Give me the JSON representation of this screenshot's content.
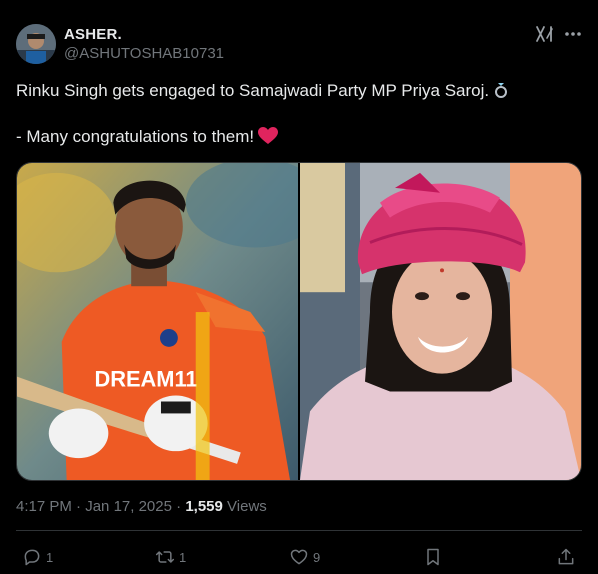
{
  "author": {
    "display_name": "ASHER.",
    "handle": "@ASHUTOSHAB10731"
  },
  "tweet": {
    "line1": "Rinku Singh gets engaged to Samajwadi Party MP Priya Saroj.",
    "line2": "- Many congratulations to them!"
  },
  "media": {
    "left_photo_jersey_text": "DREAM11",
    "photos": [
      "cricketer-photo",
      "woman-in-pink-turban-photo"
    ]
  },
  "meta": {
    "time": "4:17 PM",
    "separator": "·",
    "date": "Jan 17, 2025",
    "views_count": "1,559",
    "views_label": "Views"
  },
  "actions": {
    "replies": "1",
    "reposts": "1",
    "likes": "9"
  },
  "colors": {
    "background": "#000000",
    "text": "#e7e9ea",
    "muted": "#71767b",
    "border": "#2f3336",
    "heart": "#f91880"
  },
  "icons": [
    "grok-icon",
    "more-icon",
    "ring-icon",
    "heart-icon",
    "reply-icon",
    "retweet-icon",
    "like-icon",
    "bookmark-icon",
    "share-icon"
  ]
}
